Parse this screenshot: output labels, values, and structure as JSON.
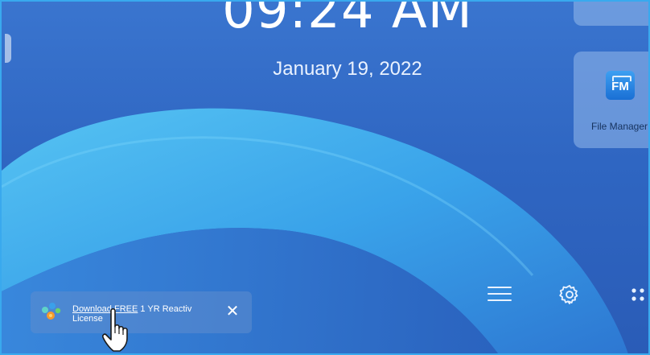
{
  "clock": {
    "time": "09:24 AM",
    "date": "January 19, 2022"
  },
  "apps": [
    {
      "label": "",
      "icon": "app-tile-partial"
    },
    {
      "label": "File Manager",
      "icon": "file-manager-icon",
      "icon_text": "FM"
    }
  ],
  "dock": [
    {
      "icon": "menu-icon"
    },
    {
      "icon": "gear-icon"
    },
    {
      "icon": "apps-grid-icon"
    }
  ],
  "notification": {
    "link_text": "Download FREE",
    "text_rest": " 1 YR Reactiv",
    "line2": "License",
    "close_glyph": "✕"
  },
  "colors": {
    "accent_border": "#39a9ee",
    "background": "#2f67c0",
    "wave": "#3fb6f0"
  }
}
